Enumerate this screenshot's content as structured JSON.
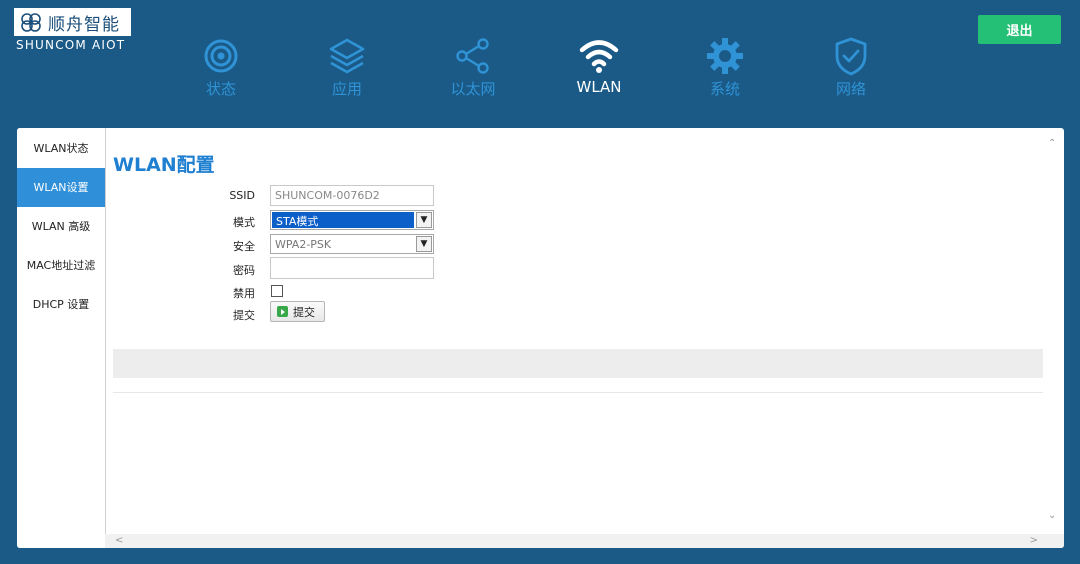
{
  "brand": {
    "name_cn": "顺舟智能",
    "name_en": "SHUNCOM AIOT"
  },
  "logout_label": "退出",
  "nav": [
    {
      "label": "状态",
      "icon": "signal-icon",
      "active": false
    },
    {
      "label": "应用",
      "icon": "layers-icon",
      "active": false
    },
    {
      "label": "以太网",
      "icon": "share-network-icon",
      "active": false
    },
    {
      "label": "WLAN",
      "icon": "wifi-icon",
      "active": true
    },
    {
      "label": "系统",
      "icon": "gear-icon",
      "active": false
    },
    {
      "label": "网络",
      "icon": "shield-check-icon",
      "active": false
    }
  ],
  "sidebar": [
    {
      "label": "WLAN状态",
      "active": false
    },
    {
      "label": "WLAN设置",
      "active": true
    },
    {
      "label": "WLAN 高级",
      "active": false
    },
    {
      "label": "MAC地址过滤",
      "active": false
    },
    {
      "label": "DHCP 设置",
      "active": false
    }
  ],
  "page_title": "WLAN配置",
  "form": {
    "ssid_label": "SSID",
    "ssid_value": "SHUNCOM-0076D2",
    "mode_label": "模式",
    "mode_value": "STA模式",
    "security_label": "安全",
    "security_value": "WPA2-PSK",
    "password_label": "密码",
    "password_value": "",
    "disable_label": "禁用",
    "submit_label": "提交",
    "submit_button": "提交"
  },
  "colors": {
    "background": "#1b5a87",
    "accent_blue": "#2f8fd8",
    "logout_green": "#23c075",
    "nav_inactive": "#2f93d6"
  }
}
